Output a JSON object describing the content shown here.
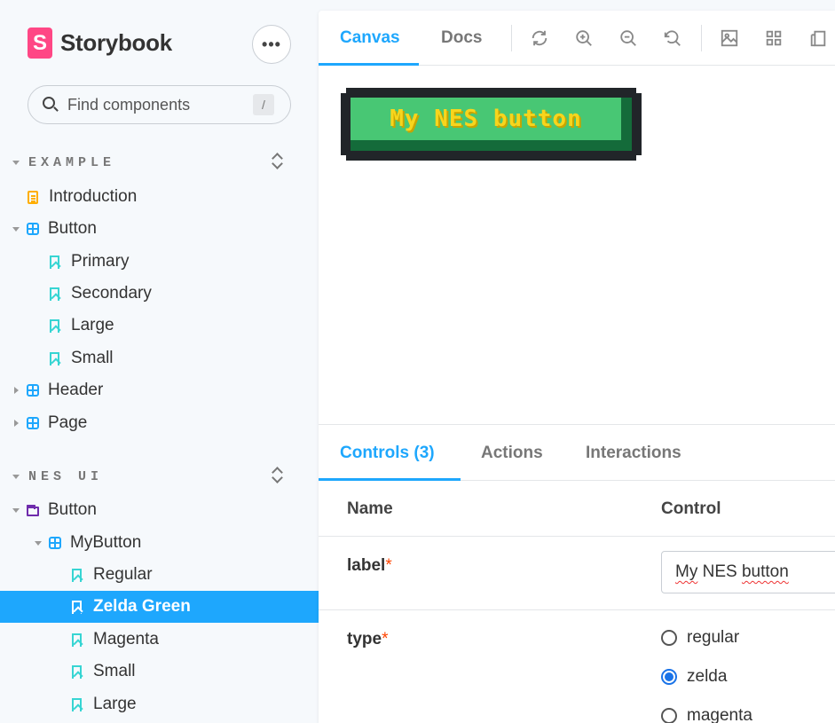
{
  "brand": {
    "name": "Storybook",
    "logo_letter": "S"
  },
  "menu_button": {
    "label": "•••"
  },
  "search": {
    "placeholder": "Find components",
    "shortcut": "/"
  },
  "sections": [
    {
      "label": "EXAMPLE"
    },
    {
      "label": "NES UI"
    }
  ],
  "tree": [
    {
      "label": "Introduction",
      "kind": "doc"
    },
    {
      "label": "Button",
      "kind": "component",
      "expanded": true
    },
    {
      "label": "Primary",
      "kind": "story"
    },
    {
      "label": "Secondary",
      "kind": "story"
    },
    {
      "label": "Large",
      "kind": "story"
    },
    {
      "label": "Small",
      "kind": "story"
    },
    {
      "label": "Header",
      "kind": "component",
      "expanded": false
    },
    {
      "label": "Page",
      "kind": "component",
      "expanded": false
    },
    {
      "label": "Button",
      "kind": "folder",
      "expanded": true
    },
    {
      "label": "MyButton",
      "kind": "component",
      "expanded": true
    },
    {
      "label": "Regular",
      "kind": "story"
    },
    {
      "label": "Zelda Green",
      "kind": "story",
      "selected": true
    },
    {
      "label": "Magenta",
      "kind": "story"
    },
    {
      "label": "Small",
      "kind": "story"
    },
    {
      "label": "Large",
      "kind": "story"
    }
  ],
  "toolbar": {
    "tabs": [
      {
        "label": "Canvas",
        "active": true
      },
      {
        "label": "Docs",
        "active": false
      }
    ],
    "icons": [
      "reload-icon",
      "zoom-in-icon",
      "zoom-out-icon",
      "zoom-reset-icon",
      "background-icon",
      "grid-icon",
      "viewport-icon"
    ]
  },
  "preview": {
    "button_label": "My NES button"
  },
  "addons": {
    "tabs": [
      {
        "label": "Controls (3)",
        "active": true
      },
      {
        "label": "Actions",
        "active": false
      },
      {
        "label": "Interactions",
        "active": false
      }
    ],
    "columns": {
      "name": "Name",
      "control": "Control"
    },
    "rows": [
      {
        "name": "label",
        "required_mark": "*",
        "value": "My NES button"
      },
      {
        "name": "type",
        "required_mark": "*",
        "options": [
          "regular",
          "zelda",
          "magenta"
        ],
        "selected": "zelda"
      }
    ]
  },
  "colors": {
    "accent": "#1ea7fd",
    "brand": "#ff4785",
    "nes_green": "#48c774",
    "nes_text": "#f7d51d"
  }
}
